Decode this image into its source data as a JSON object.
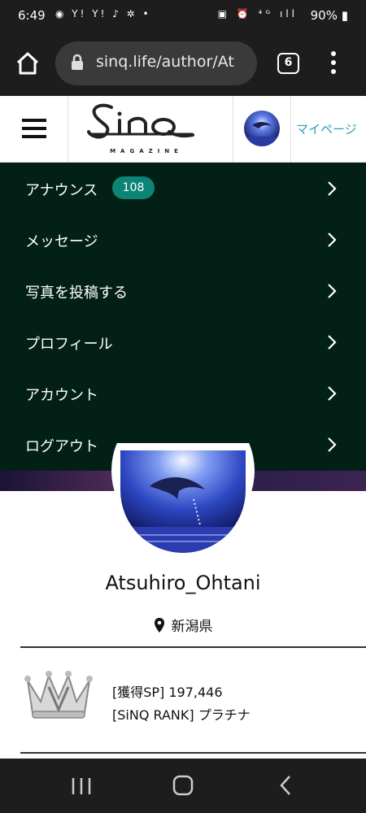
{
  "status_bar": {
    "time": "6:49",
    "left_icons": "◉ Y! Y! ♪ ✲ •",
    "right_icons": "▣ ⏰ ⁴ᴳ ıll",
    "battery": "90%"
  },
  "browser": {
    "url": "sinq.life/author/At",
    "tab_count": "6"
  },
  "header": {
    "logo_text": "Sinq",
    "logo_sub": "MAGAZINE",
    "mypage_label": "マイページ"
  },
  "menu": {
    "items": [
      {
        "label": "アナウンス",
        "badge": "108"
      },
      {
        "label": "メッセージ"
      },
      {
        "label": "写真を投稿する"
      },
      {
        "label": "プロフィール"
      },
      {
        "label": "アカウント"
      },
      {
        "label": "ログアウト"
      }
    ]
  },
  "profile": {
    "username": "Atsuhiro_Ohtani",
    "location": "新潟県",
    "sp_line": "[獲得SP] 197,446",
    "rank_line": "[SiNQ RANK] プラチナ"
  },
  "colors": {
    "menu_bg": "#032016",
    "badge_bg": "#0c8576",
    "link": "#2a9fbb",
    "chrome_bg": "#1d1d1d"
  }
}
